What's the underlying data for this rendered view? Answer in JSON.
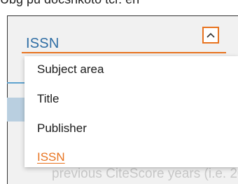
{
  "dropdown": {
    "selected_value": "ISSN",
    "toggle_icon": "chevron-up-icon",
    "options": [
      {
        "label": "Subject area",
        "selected": false
      },
      {
        "label": "Title",
        "selected": false
      },
      {
        "label": "Publisher",
        "selected": false
      },
      {
        "label": "ISSN",
        "selected": true
      }
    ]
  },
  "background": {
    "caption_fragment": "Ubg pu docsnkoto tcr. en",
    "bottom_text": "previous CiteScore years (i.e. 20"
  },
  "colors": {
    "accent_orange": "#e8731f",
    "link_blue": "#2e6da4",
    "menu_text": "#1a1a1a"
  }
}
